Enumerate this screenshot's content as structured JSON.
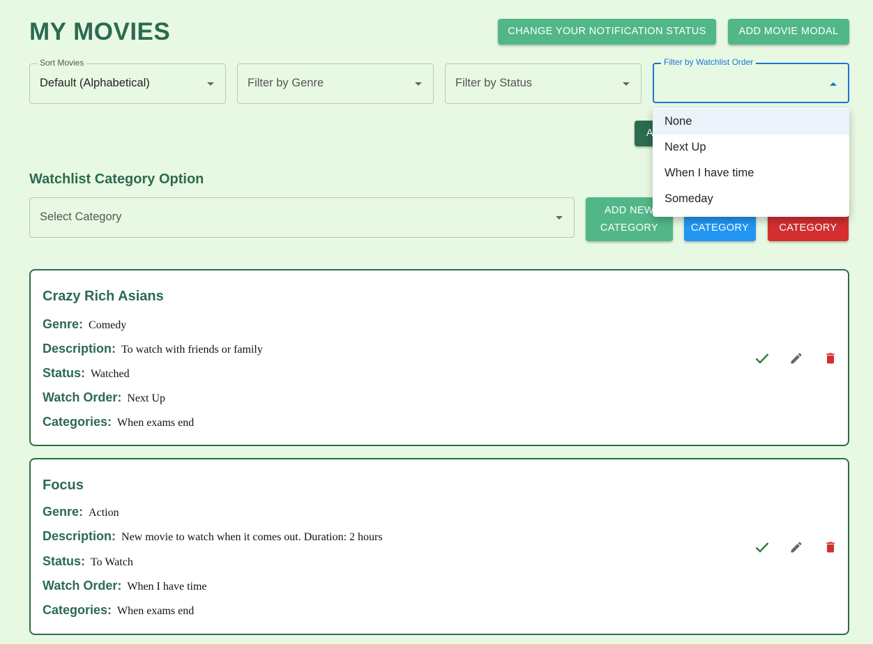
{
  "page": {
    "title": "MY MOVIES"
  },
  "header": {
    "notification_button": "CHANGE YOUR NOTIFICATION STATUS",
    "add_movie_button": "ADD MOVIE MODAL"
  },
  "filters": {
    "sort": {
      "label": "Sort Movies",
      "value": "Default (Alphabetical)"
    },
    "genre": {
      "placeholder": "Filter by Genre"
    },
    "status": {
      "placeholder": "Filter by Status"
    },
    "watch_order": {
      "label": "Filter by Watchlist Order",
      "value": ""
    }
  },
  "hidden_button_label": "A",
  "dropdown": {
    "options": [
      "None",
      "Next Up",
      "When I have time",
      "Someday"
    ],
    "highlighted_index": 0
  },
  "category": {
    "section_title": "Watchlist Category Option",
    "select_placeholder": "Select Category",
    "add_button": "ADD NEW CATEGORY",
    "add_button_line1": "ADD NEW",
    "add_button_line2": "CATEGORY",
    "edit_button": "CATEGORY",
    "delete_button": "CATEGORY"
  },
  "field_labels": {
    "genre": "Genre:",
    "description": "Description:",
    "status": "Status:",
    "watch_order": "Watch Order:",
    "categories": "Categories:"
  },
  "movies": [
    {
      "title": "Crazy Rich Asians",
      "genre": "Comedy",
      "description": "To watch with friends or family",
      "status": "Watched",
      "watch_order": "Next Up",
      "categories": "When exams end"
    },
    {
      "title": "Focus",
      "genre": "Action",
      "description": "New movie to watch when it comes out. Duration: 2 hours",
      "status": "To Watch",
      "watch_order": "When I have time",
      "categories": "When exams end"
    }
  ],
  "icons": {
    "done": "check-icon",
    "edit": "pencil-icon",
    "delete": "trash-icon"
  },
  "colors": {
    "background": "#e8f9e3",
    "primary_dark": "#2b6b4f",
    "primary": "#52b788",
    "blue": "#2196f3",
    "red": "#d32f2f",
    "check": "#2e7d32"
  }
}
